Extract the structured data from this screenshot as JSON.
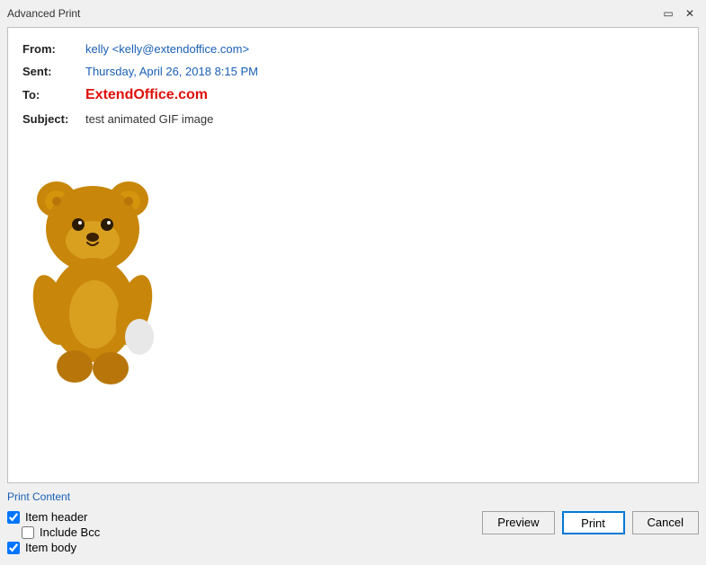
{
  "window": {
    "title": "Advanced Print"
  },
  "titlebar": {
    "title": "Advanced Print",
    "minimize_label": "🗕",
    "maximize_label": "🗖",
    "close_label": "✕"
  },
  "email": {
    "from_label": "From:",
    "from_value": "kelly <kelly@extendoffice.com>",
    "sent_label": "Sent:",
    "sent_value": "Thursday, April 26, 2018  8:15 PM",
    "to_label": "To:",
    "to_value": "ExtendOffice.com",
    "subject_label": "Subject:",
    "subject_value": "test animated GIF image"
  },
  "print_content": {
    "label": "Print Content",
    "item_header_label": "Item header",
    "include_bcc_label": "Include Bcc",
    "item_body_label": "Item body"
  },
  "buttons": {
    "preview": "Preview",
    "print": "Print",
    "cancel": "Cancel"
  },
  "checkboxes": {
    "item_header_checked": true,
    "include_bcc_checked": false,
    "item_body_checked": true
  }
}
